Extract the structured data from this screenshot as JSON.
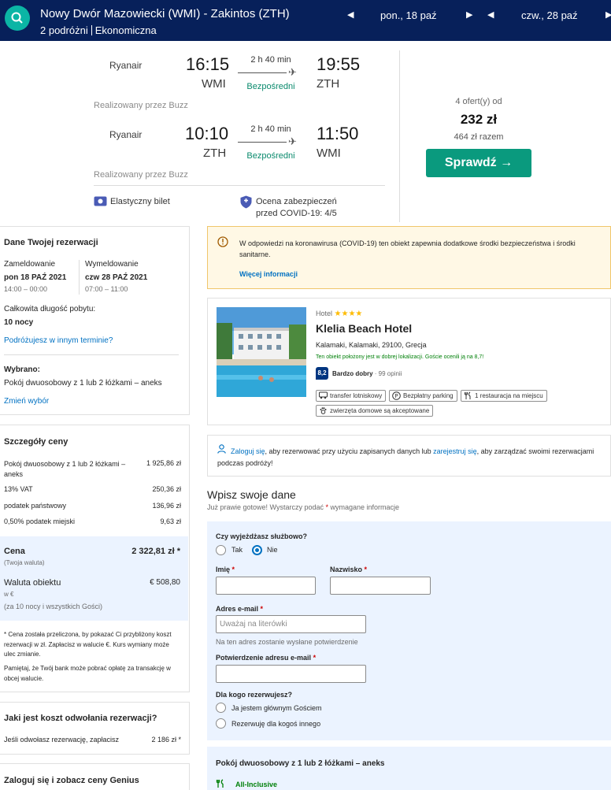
{
  "header": {
    "route": "Nowy Dwór Mazowiecki (WMI) - Zakintos (ZTH)",
    "travellers": "2 podróżni",
    "cabin": "Ekonomiczna",
    "depart_date": "pon., 18 paź",
    "return_date": "czw., 28 paź"
  },
  "flight": {
    "outbound": {
      "airline": "Ryanair",
      "dep_time": "16:15",
      "dep_code": "WMI",
      "duration": "2 h 40 min",
      "stops": "Bezpośredni",
      "arr_time": "19:55",
      "arr_code": "ZTH",
      "operated": "Realizowany przez Buzz"
    },
    "inbound": {
      "airline": "Ryanair",
      "dep_time": "10:10",
      "dep_code": "ZTH",
      "duration": "2 h 40 min",
      "stops": "Bezpośredni",
      "arr_time": "11:50",
      "arr_code": "WMI",
      "operated": "Realizowany przez Buzz"
    },
    "flexible": "Elastyczny bilet",
    "covid_line1": "Ocena zabezpieczeń",
    "covid_line2": "przed COVID-19: 4/5",
    "offers": "4 ofert(y) od",
    "price": "232 zł",
    "total": "464 zł razem",
    "check_button": "Sprawdź →"
  },
  "booking": {
    "title": "Dane Twojej rezerwacji",
    "checkin_label": "Zameldowanie",
    "checkin_date": "pon 18 PAŹ 2021",
    "checkin_time": "14:00 – 00:00",
    "checkout_label": "Wymeldowanie",
    "checkout_date": "czw 28 PAŹ 2021",
    "checkout_time": "07:00 – 11:00",
    "stay_label": "Całkowita długość pobytu:",
    "stay_value": "10 nocy",
    "other_dates_link": "Podróżujesz w innym terminie?",
    "selected_label": "Wybrano:",
    "selected_value": "Pokój dwuosobowy z 1 lub 2 łóżkami – aneks",
    "change_link": "Zmień wybór"
  },
  "price_details": {
    "title": "Szczegóły ceny",
    "rows": [
      {
        "label": "Pokój dwuosobowy z 1 lub 2 łóżkami – aneks",
        "value": "1 925,86 zł"
      },
      {
        "label": "13% VAT",
        "value": "250,36 zł"
      },
      {
        "label": "podatek państwowy",
        "value": "136,96 zł"
      },
      {
        "label": "0,50% podatek miejski",
        "value": "9,63 zł"
      }
    ],
    "price_label": "Cena",
    "price_value": "2 322,81 zł *",
    "currency_note": "(Twoja waluta)",
    "property_currency_label": "Waluta obiektu",
    "property_currency_value": "€ 508,80",
    "property_currency_sub1": "w €",
    "property_currency_sub2": "(za 10 nocy i wszystkich Gości)",
    "note1": "* Cena została przeliczona, by pokazać Ci przybliżony koszt rezerwacji w zł. Zapłacisz w walucie €. Kurs wymiany może ulec zmianie.",
    "note2": "Pamiętaj, że Twój bank może pobrać opłatę za transakcję w obcej walucie."
  },
  "cancellation": {
    "title": "Jaki jest koszt odwołania rezerwacji?",
    "text": "Jeśli odwołasz rezerwację, zapłacisz",
    "value": "2 186 zł *"
  },
  "genius": {
    "title": "Zaloguj się i zobacz ceny Genius"
  },
  "covid_notice": {
    "text": "W odpowiedzi na koronawirusa (COVID-19) ten obiekt zapewnia dodatkowe środki bezpieczeństwa i środki sanitarne.",
    "link": "Więcej informacji"
  },
  "hotel": {
    "type": "Hotel",
    "stars": "★★★★",
    "name": "Klelia Beach Hotel",
    "address": "Kalamaki, Kalamaki, 29100, Grecja",
    "location_note": "Ten obiekt położony jest w dobrej lokalizacji. Goście ocenili ją na 8,7!",
    "score": "8,2",
    "score_label": "Bardzo dobry",
    "reviews": "· 99 opinii",
    "facilities": [
      "transfer lotniskowy",
      "Bezpłatny parking",
      "1 restauracja na miejscu",
      "zwierzęta domowe są akceptowane"
    ]
  },
  "signin": {
    "link": "Zaloguj się",
    "text1": ", aby rezerwować przy użyciu zapisanych danych lub ",
    "register_link": "zarejestruj się",
    "text2": ", aby zarządzać swoimi rezerwacjami podczas podróży!"
  },
  "form": {
    "title": "Wpisz swoje dane",
    "subtitle_a": "Już prawie gotowe! Wystarczy podać ",
    "subtitle_star": "*",
    "subtitle_b": " wymagane informacje",
    "business_q": "Czy wyjeżdżasz służbowo?",
    "yes": "Tak",
    "no": "Nie",
    "first_name": "Imię",
    "last_name": "Nazwisko",
    "email": "Adres e-mail",
    "email_placeholder": "Uważaj na literówki",
    "email_hint": "Na ten adres zostanie wysłane potwierdzenie",
    "email_confirm": "Potwierdzenie adresu e-mail",
    "star": "*",
    "for_whom": "Dla kogo rezerwujesz?",
    "main_guest": "Ja jestem głównym Gościem",
    "other": "Rezerwuję dla kogoś innego"
  },
  "room": {
    "title": "Pokój dwuosobowy z 1 lub 2 łóżkami – aneks",
    "board": "All-Inclusive"
  },
  "colors": {
    "navy": "#07205a",
    "teal": "#0bb5a5",
    "green": "#0a9a7e",
    "blue": "#0071c2",
    "score": "#003580"
  }
}
